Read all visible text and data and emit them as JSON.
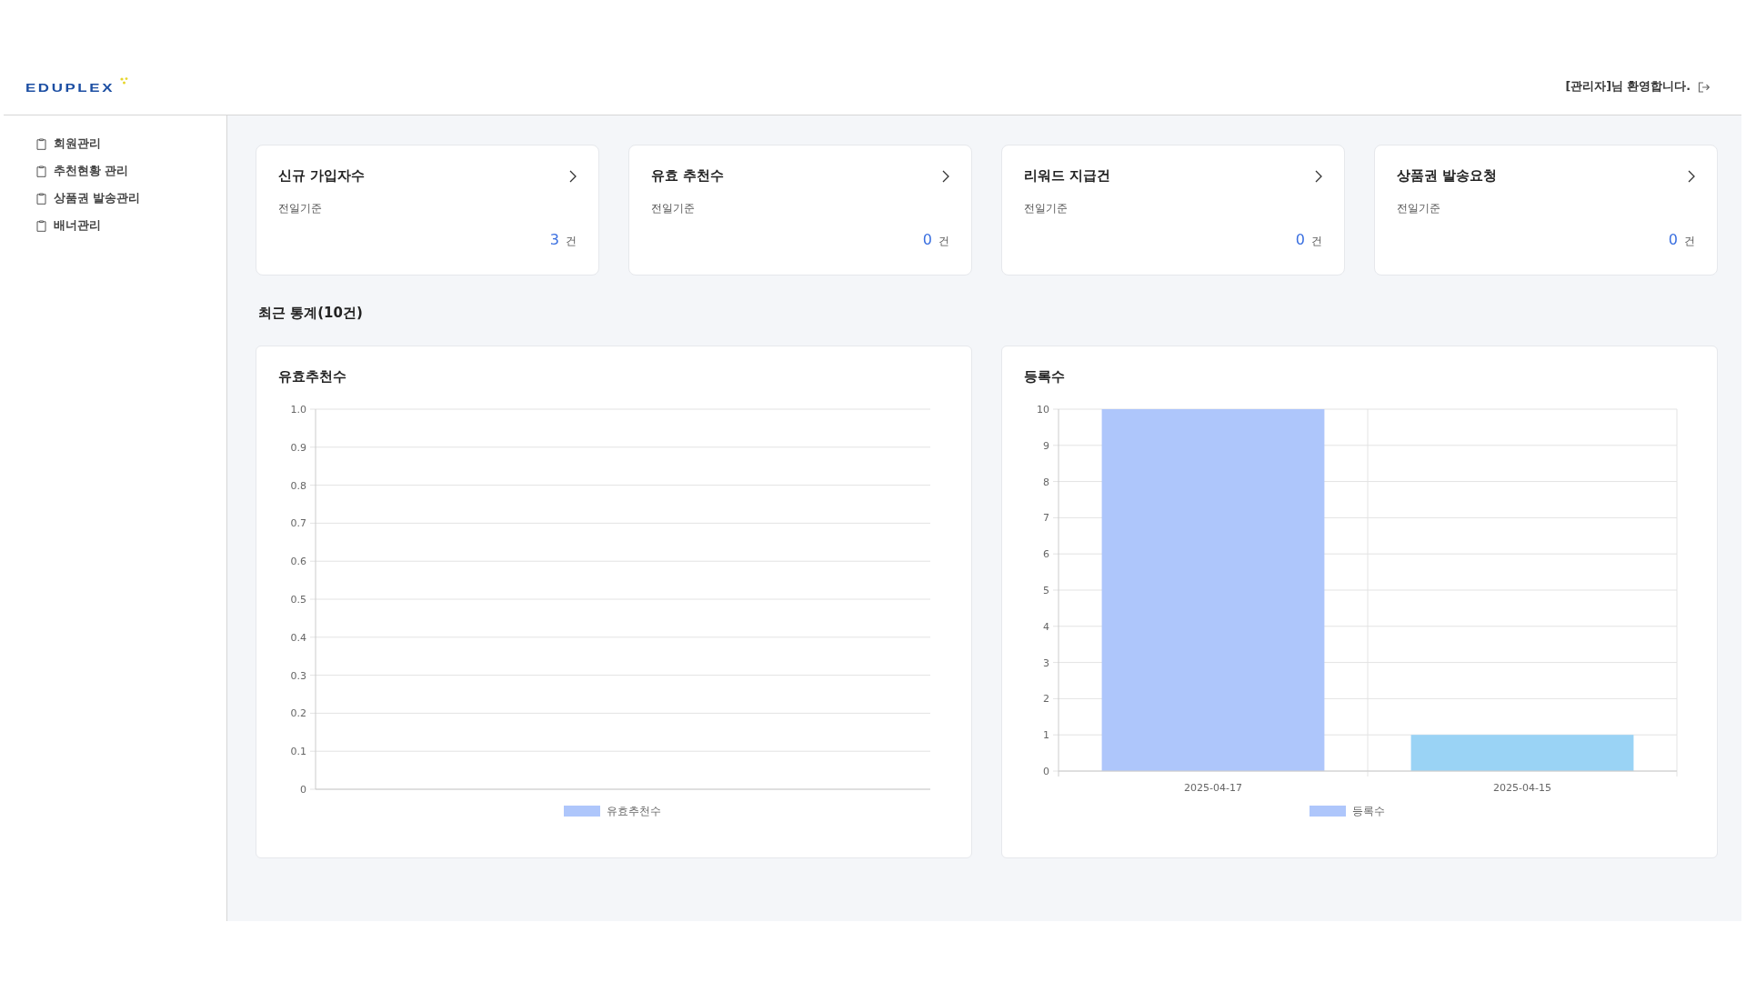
{
  "header": {
    "logo": "EDUPLEX",
    "welcome": "[관리자]님 환영합니다."
  },
  "sidebar": {
    "items": [
      {
        "label": "회원관리"
      },
      {
        "label": "추천현황 관리"
      },
      {
        "label": "상품권 발송관리"
      },
      {
        "label": "배너관리"
      }
    ]
  },
  "cards": [
    {
      "title": "신규 가입자수",
      "subtitle": "전일기준",
      "value": "3",
      "unit": "건"
    },
    {
      "title": "유효 추천수",
      "subtitle": "전일기준",
      "value": "0",
      "unit": "건"
    },
    {
      "title": "리워드 지급건",
      "subtitle": "전일기준",
      "value": "0",
      "unit": "건"
    },
    {
      "title": "상품권 발송요청",
      "subtitle": "전일기준",
      "value": "0",
      "unit": "건"
    }
  ],
  "section_title": "최근 통계(10건)",
  "charts": [
    {
      "title": "유효추천수",
      "chart_data": {
        "type": "line",
        "grid": true,
        "ylim": [
          0,
          1
        ],
        "yticks": [
          0,
          0.1,
          0.2,
          0.3,
          0.4,
          0.5,
          0.6,
          0.7,
          0.8,
          0.9,
          {
            "value": 1,
            "label": "1.0"
          }
        ],
        "series": [
          {
            "name": "유효추천수",
            "color": "#aec6fb"
          }
        ]
      }
    },
    {
      "title": "등록수",
      "chart_data": {
        "type": "bar",
        "grid": true,
        "stacked": true,
        "categories": [
          "2025-04-17",
          "2025-04-15"
        ],
        "ylim": [
          0,
          10
        ],
        "yticks": [
          0,
          1,
          2,
          3,
          4,
          5,
          6,
          7,
          8,
          9,
          10
        ],
        "series": [
          {
            "name": "등록수",
            "color": "#aec6fb",
            "values": [
              10,
              null
            ]
          },
          {
            "color": "#9ad3f5",
            "values": [
              null,
              1
            ]
          }
        ]
      }
    }
  ]
}
